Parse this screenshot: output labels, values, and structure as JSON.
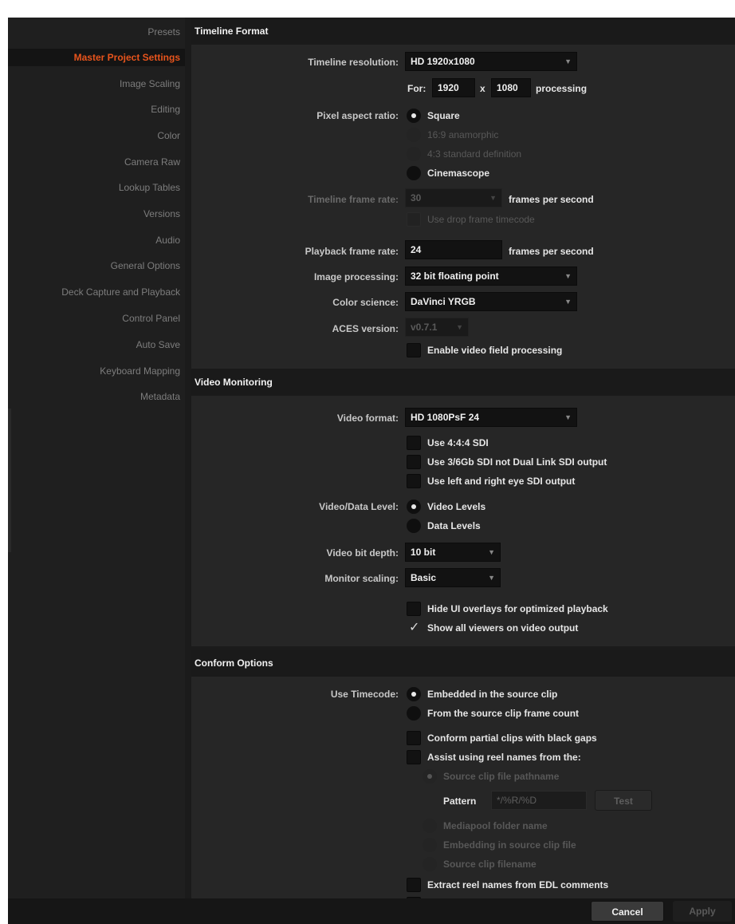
{
  "sidebar": {
    "items": [
      {
        "label": "Presets"
      },
      {
        "label": "Master Project Settings"
      },
      {
        "label": "Image Scaling"
      },
      {
        "label": "Editing"
      },
      {
        "label": "Color"
      },
      {
        "label": "Camera Raw"
      },
      {
        "label": "Lookup Tables"
      },
      {
        "label": "Versions"
      },
      {
        "label": "Audio"
      },
      {
        "label": "General Options"
      },
      {
        "label": "Deck Capture and Playback"
      },
      {
        "label": "Control Panel"
      },
      {
        "label": "Auto Save"
      },
      {
        "label": "Keyboard Mapping"
      },
      {
        "label": "Metadata"
      }
    ],
    "active_item": "Master Project Settings"
  },
  "timeline_format": {
    "header": "Timeline Format",
    "resolution_label": "Timeline resolution:",
    "resolution_value": "HD 1920x1080",
    "for_label": "For:",
    "width_value": "1920",
    "x_label": "x",
    "height_value": "1080",
    "processing_label": "processing",
    "pixel_aspect_label": "Pixel aspect ratio:",
    "pixel_aspect_options": [
      "Square",
      "16:9 anamorphic",
      "4:3 standard definition",
      "Cinemascope"
    ],
    "pixel_aspect_selected": "Square",
    "frame_rate_label": "Timeline frame rate:",
    "frame_rate_value": "30",
    "fps_label": "frames per second",
    "drop_frame_label": "Use drop frame timecode",
    "playback_label": "Playback frame rate:",
    "playback_value": "24",
    "playback_fps_label": "frames per second",
    "image_processing_label": "Image processing:",
    "image_processing_value": "32 bit floating point",
    "color_science_label": "Color science:",
    "color_science_value": "DaVinci YRGB",
    "aces_label": "ACES version:",
    "aces_value": "v0.7.1",
    "video_field_label": "Enable video field processing"
  },
  "video_monitoring": {
    "header": "Video Monitoring",
    "video_format_label": "Video format:",
    "video_format_value": "HD 1080PsF 24",
    "use_444_label": "Use 4:4:4 SDI",
    "use_36gb_label": "Use 3/6Gb SDI not Dual Link SDI output",
    "use_eye_label": "Use left and right eye SDI output",
    "data_level_label": "Video/Data Level:",
    "data_level_options": [
      "Video Levels",
      "Data Levels"
    ],
    "data_level_selected": "Video Levels",
    "bit_depth_label": "Video bit depth:",
    "bit_depth_value": "10 bit",
    "monitor_scaling_label": "Monitor scaling:",
    "monitor_scaling_value": "Basic",
    "hide_ui_label": "Hide UI overlays for optimized playback",
    "hide_ui_checked": false,
    "show_viewers_label": "Show all viewers on video output",
    "show_viewers_checked": true
  },
  "conform_options": {
    "header": "Conform Options",
    "timecode_label": "Use Timecode:",
    "timecode_options": [
      "Embedded in the source clip",
      "From the source clip frame count"
    ],
    "timecode_selected": "Embedded in the source clip",
    "partial_clips_label": "Conform partial clips with black gaps",
    "assist_label": "Assist using reel names from the:",
    "assist_options": [
      "Source clip file pathname",
      "Mediapool folder name",
      "Embedding in source clip file",
      "Source clip filename"
    ],
    "pattern_label": "Pattern",
    "pattern_placeholder": "*/%R/%D",
    "test_label": "Test",
    "extract_label": "Extract reel names from EDL comments"
  },
  "footer": {
    "cancel_label": "Cancel",
    "apply_label": "Apply"
  }
}
